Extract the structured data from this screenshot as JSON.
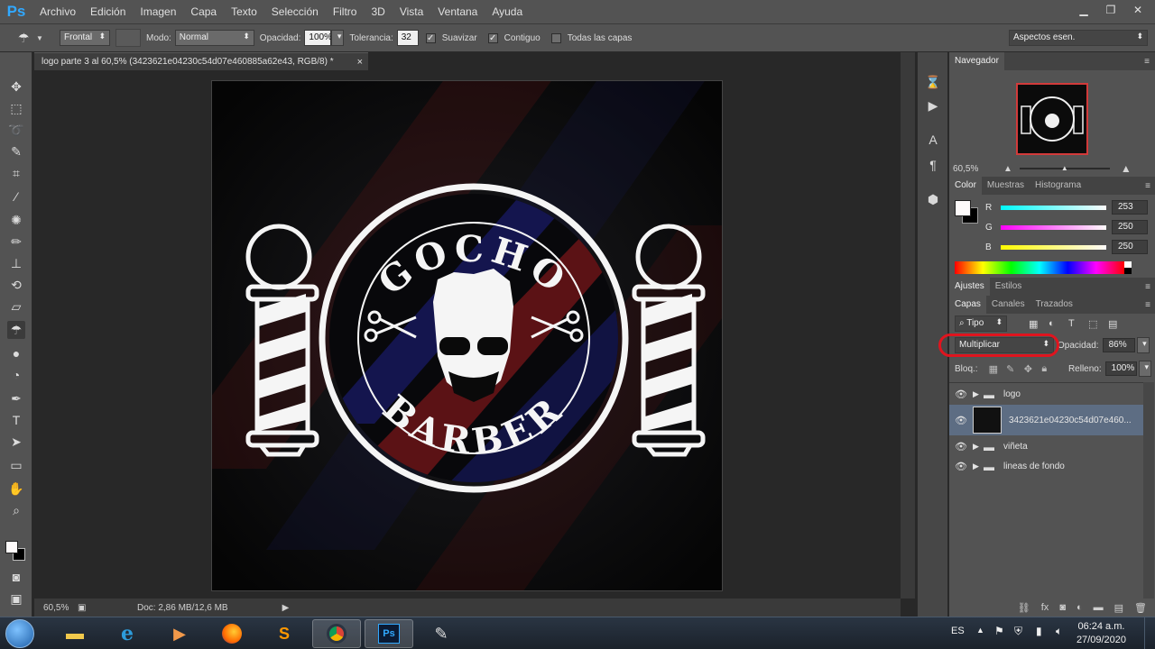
{
  "menu": {
    "logo": "Ps",
    "items": [
      "Archivo",
      "Edición",
      "Imagen",
      "Capa",
      "Texto",
      "Selección",
      "Filtro",
      "3D",
      "Vista",
      "Ventana",
      "Ayuda"
    ]
  },
  "options": {
    "frontal": "Frontal",
    "modo_label": "Modo:",
    "modo_value": "Normal",
    "opacidad_label": "Opacidad:",
    "opacidad_value": "100%",
    "tolerancia_label": "Tolerancia:",
    "tolerancia_value": "32",
    "suavizar": "Suavizar",
    "contiguo": "Contiguo",
    "todas": "Todas las capas",
    "workspace": "Aspectos esen."
  },
  "document": {
    "tab_title": "logo parte 3 al 60,5% (3423621e04230c54d07e460885a62e43, RGB/8) *",
    "zoom": "60,5%",
    "doc_info": "Doc: 2,86 MB/12,6 MB"
  },
  "logo_art": {
    "top_text": "GOCHO",
    "bottom_text": "BARBER"
  },
  "navigator": {
    "title": "Navegador",
    "zoom": "60,5%"
  },
  "color_panel": {
    "tabs": [
      "Color",
      "Muestras",
      "Histograma"
    ],
    "r_label": "R",
    "r": "253",
    "g_label": "G",
    "g": "250",
    "b_label": "B",
    "b": "250"
  },
  "adjust_tabs": [
    "Ajustes",
    "Estilos"
  ],
  "layers_panel": {
    "tabs": [
      "Capas",
      "Canales",
      "Trazados"
    ],
    "filter": "Tipo",
    "blend_mode": "Multiplicar",
    "opacity_label": "Opacidad:",
    "opacity": "86%",
    "lock_label": "Bloq.:",
    "fill_label": "Relleno:",
    "fill": "100%",
    "layers": [
      {
        "name": "logo",
        "kind": "folder"
      },
      {
        "name": "3423621e04230c54d07e460...",
        "kind": "image",
        "selected": true
      },
      {
        "name": "viñeta",
        "kind": "folder"
      },
      {
        "name": "lineas de fondo",
        "kind": "folder"
      }
    ]
  },
  "taskbar": {
    "language": "ES",
    "time": "06:24 a.m.",
    "date": "27/09/2020"
  },
  "colors": {
    "accent_blue": "#31a8ff",
    "annotation_red": "#e0141e",
    "selected_layer": "#5d6d83"
  }
}
